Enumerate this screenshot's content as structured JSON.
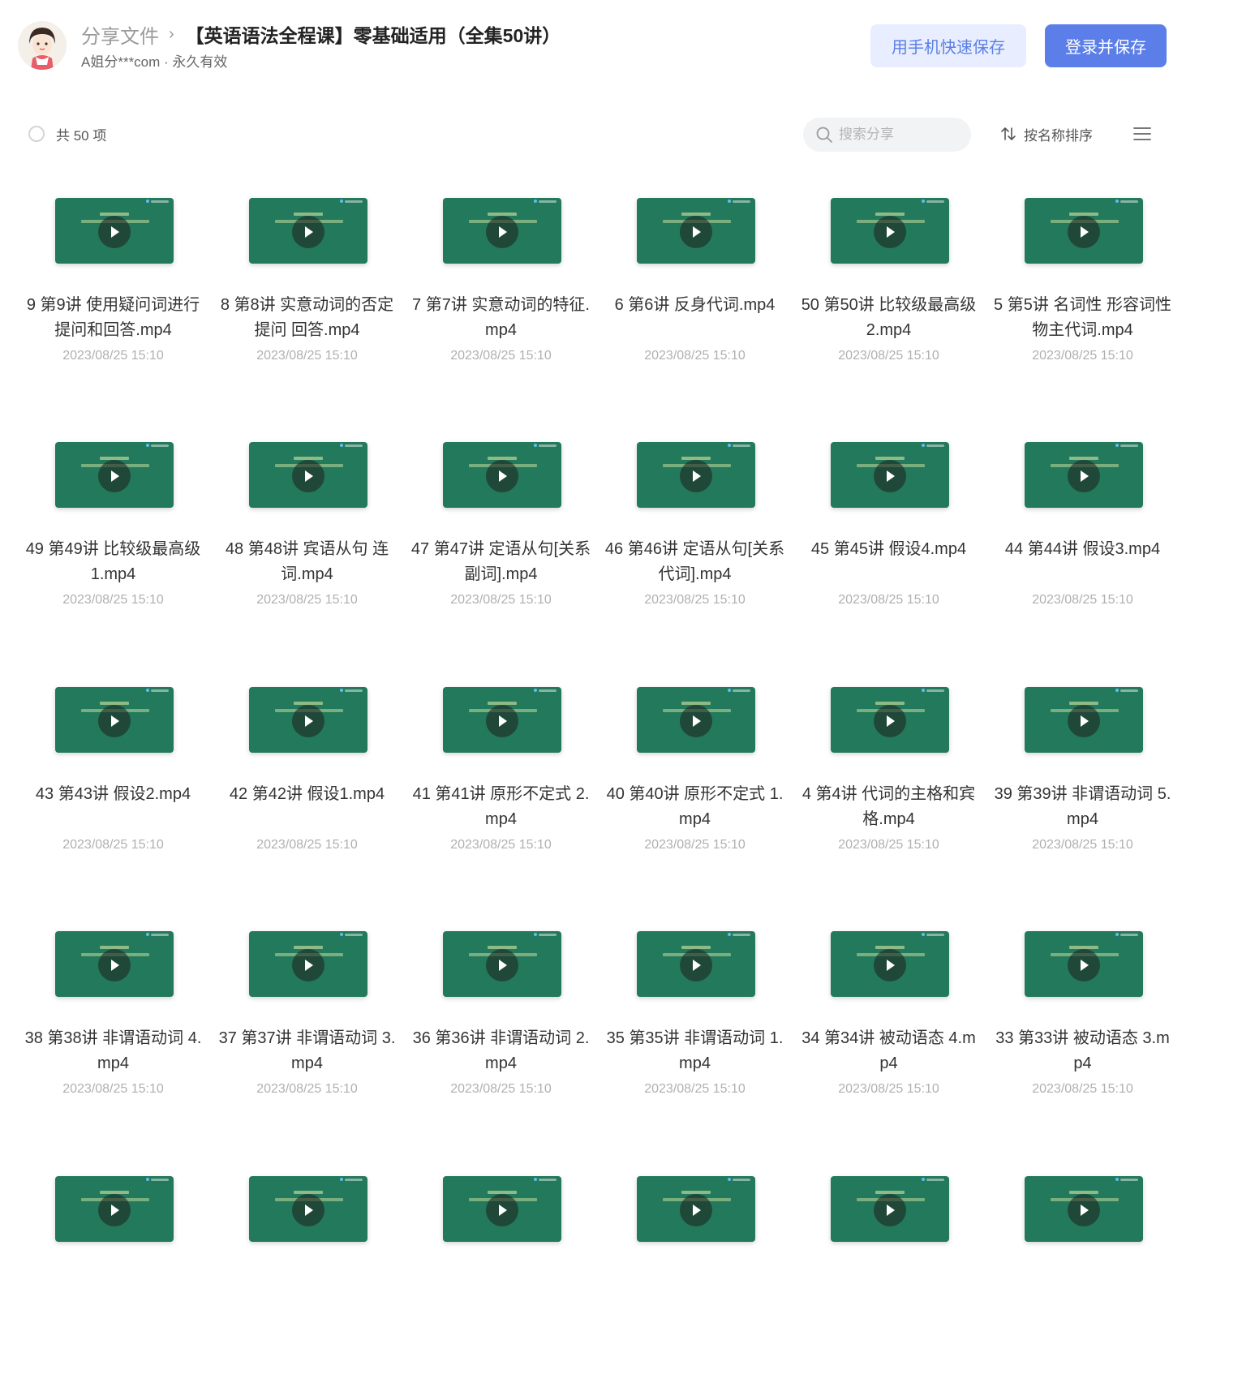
{
  "header": {
    "breadcrumb_parent": "分享文件",
    "breadcrumb_separator": "›",
    "title": "【英语语法全程课】零基础适用（全集50讲）",
    "owner_line": "A姐分***com · 永久有效",
    "save_phone_label": "用手机快速保存",
    "login_save_label": "登录并保存"
  },
  "toolbar": {
    "count_label": "共 50 项",
    "search_placeholder": "搜索分享",
    "sort_label": "按名称排序",
    "icons": {
      "search": "search-icon",
      "sort": "sort-arrows-icon",
      "view": "list-view-icon"
    }
  },
  "colors": {
    "accent": "#5b7ee8",
    "accent_light": "#e8eeff",
    "thumbnail": "#23795b"
  },
  "files": [
    {
      "name": "9 第9讲 使用疑问词进行提问和回答.mp4",
      "date": "2023/08/25 15:10"
    },
    {
      "name": "8 第8讲 实意动词的否定 提问 回答.mp4",
      "date": "2023/08/25 15:10"
    },
    {
      "name": "7 第7讲 实意动词的特征.mp4",
      "date": "2023/08/25 15:10"
    },
    {
      "name": "6 第6讲 反身代词.mp4",
      "date": "2023/08/25 15:10"
    },
    {
      "name": "50 第50讲 比较级最高级 2.mp4",
      "date": "2023/08/25 15:10"
    },
    {
      "name": "5 第5讲 名词性 形容词性物主代词.mp4",
      "date": "2023/08/25 15:10"
    },
    {
      "name": "49 第49讲 比较级最高级 1.mp4",
      "date": "2023/08/25 15:10"
    },
    {
      "name": "48 第48讲 宾语从句 连词.mp4",
      "date": "2023/08/25 15:10"
    },
    {
      "name": "47 第47讲 定语从句[关系副词].mp4",
      "date": "2023/08/25 15:10"
    },
    {
      "name": "46 第46讲 定语从句[关系代词].mp4",
      "date": "2023/08/25 15:10"
    },
    {
      "name": "45 第45讲 假设4.mp4",
      "date": "2023/08/25 15:10"
    },
    {
      "name": "44 第44讲 假设3.mp4",
      "date": "2023/08/25 15:10"
    },
    {
      "name": "43 第43讲 假设2.mp4",
      "date": "2023/08/25 15:10"
    },
    {
      "name": "42 第42讲 假设1.mp4",
      "date": "2023/08/25 15:10"
    },
    {
      "name": "41 第41讲 原形不定式 2.mp4",
      "date": "2023/08/25 15:10"
    },
    {
      "name": "40 第40讲 原形不定式 1.mp4",
      "date": "2023/08/25 15:10"
    },
    {
      "name": "4 第4讲 代词的主格和宾格.mp4",
      "date": "2023/08/25 15:10"
    },
    {
      "name": "39 第39讲 非谓语动词 5.mp4",
      "date": "2023/08/25 15:10"
    },
    {
      "name": "38 第38讲 非谓语动词 4.mp4",
      "date": "2023/08/25 15:10"
    },
    {
      "name": "37 第37讲 非谓语动词 3.mp4",
      "date": "2023/08/25 15:10"
    },
    {
      "name": "36 第36讲 非谓语动词 2.mp4",
      "date": "2023/08/25 15:10"
    },
    {
      "name": "35 第35讲 非谓语动词 1.mp4",
      "date": "2023/08/25 15:10"
    },
    {
      "name": "34 第34讲 被动语态 4.mp4",
      "date": "2023/08/25 15:10"
    },
    {
      "name": "33 第33讲 被动语态 3.mp4",
      "date": "2023/08/25 15:10"
    },
    {
      "name": "",
      "date": ""
    },
    {
      "name": "",
      "date": ""
    },
    {
      "name": "",
      "date": ""
    },
    {
      "name": "",
      "date": ""
    },
    {
      "name": "",
      "date": ""
    },
    {
      "name": "",
      "date": ""
    }
  ]
}
